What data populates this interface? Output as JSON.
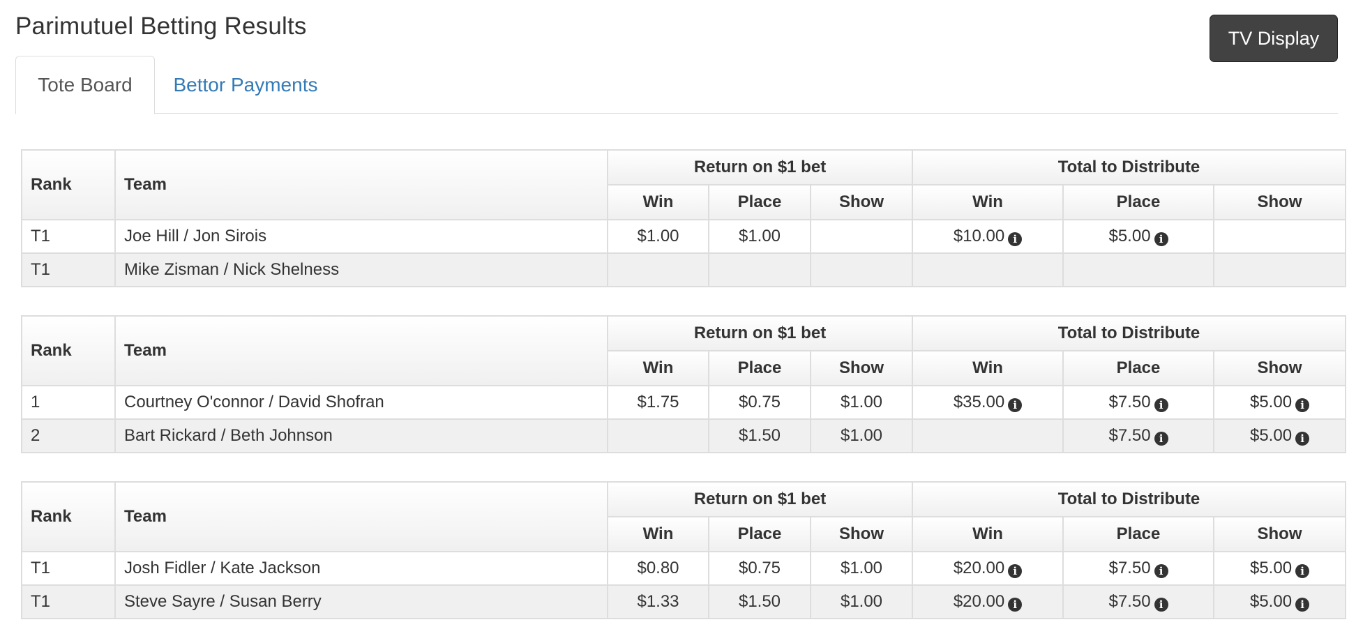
{
  "page": {
    "title": "Parimutuel Betting Results"
  },
  "toolbar": {
    "tv_display_label": "TV Display"
  },
  "tabs": [
    {
      "label": "Tote Board",
      "active": true
    },
    {
      "label": "Bettor Payments",
      "active": false
    }
  ],
  "headers": {
    "rank": "Rank",
    "team": "Team",
    "return_group": "Return on $1 bet",
    "total_group": "Total to Distribute",
    "win": "Win",
    "place": "Place",
    "show": "Show"
  },
  "info_icon": "info-circle-icon",
  "tables": [
    {
      "rows": [
        {
          "rank": "T1",
          "team": "Joe Hill / Jon Sirois",
          "ret_win": "$1.00",
          "ret_place": "$1.00",
          "ret_show": "",
          "tot_win": "$10.00",
          "tot_place": "$5.00",
          "tot_show": ""
        },
        {
          "rank": "T1",
          "team": "Mike Zisman / Nick Shelness",
          "ret_win": "",
          "ret_place": "",
          "ret_show": "",
          "tot_win": "",
          "tot_place": "",
          "tot_show": ""
        }
      ]
    },
    {
      "rows": [
        {
          "rank": "1",
          "team": "Courtney O'connor / David Shofran",
          "ret_win": "$1.75",
          "ret_place": "$0.75",
          "ret_show": "$1.00",
          "tot_win": "$35.00",
          "tot_place": "$7.50",
          "tot_show": "$5.00"
        },
        {
          "rank": "2",
          "team": "Bart Rickard / Beth Johnson",
          "ret_win": "",
          "ret_place": "$1.50",
          "ret_show": "$1.00",
          "tot_win": "",
          "tot_place": "$7.50",
          "tot_show": "$5.00"
        }
      ]
    },
    {
      "rows": [
        {
          "rank": "T1",
          "team": "Josh Fidler / Kate Jackson",
          "ret_win": "$0.80",
          "ret_place": "$0.75",
          "ret_show": "$1.00",
          "tot_win": "$20.00",
          "tot_place": "$7.50",
          "tot_show": "$5.00"
        },
        {
          "rank": "T1",
          "team": "Steve Sayre / Susan Berry",
          "ret_win": "$1.33",
          "ret_place": "$1.50",
          "ret_show": "$1.00",
          "tot_win": "$20.00",
          "tot_place": "$7.50",
          "tot_show": "$5.00"
        }
      ]
    }
  ]
}
